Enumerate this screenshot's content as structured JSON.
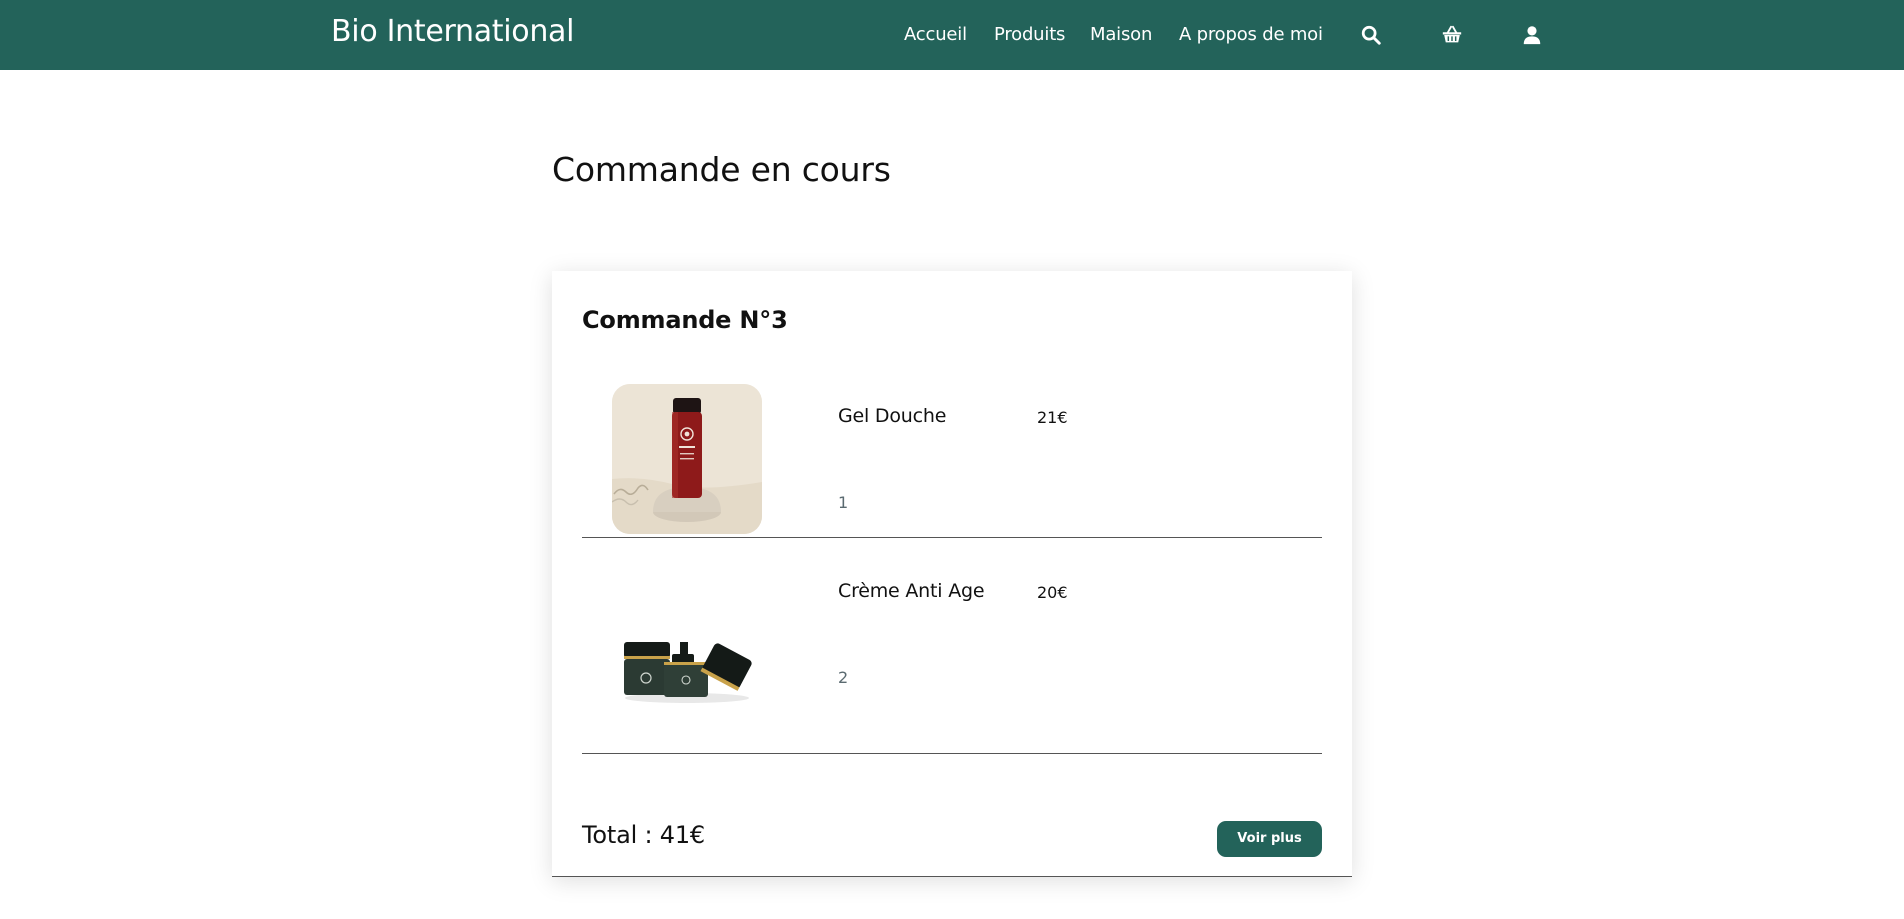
{
  "brand": "Bio International",
  "nav": {
    "accueil": "Accueil",
    "produits": "Produits",
    "maison": "Maison",
    "apropos": "A propos de moi",
    "icons": [
      "search-icon",
      "basket-icon",
      "user-icon"
    ]
  },
  "page": {
    "title": "Commande en cours"
  },
  "order": {
    "title": "Commande N°3",
    "items": [
      {
        "name": "Gel Douche",
        "price": "21€",
        "quantity": "1",
        "image": "shower-gel-bottle"
      },
      {
        "name": "Crème Anti Age",
        "price": "20€",
        "quantity": "2",
        "image": "anti-age-cream-jars"
      }
    ],
    "total": "Total : 41€",
    "more_button": "Voir plus"
  },
  "colors": {
    "brand_green": "#23635a",
    "background": "#ffffff"
  }
}
